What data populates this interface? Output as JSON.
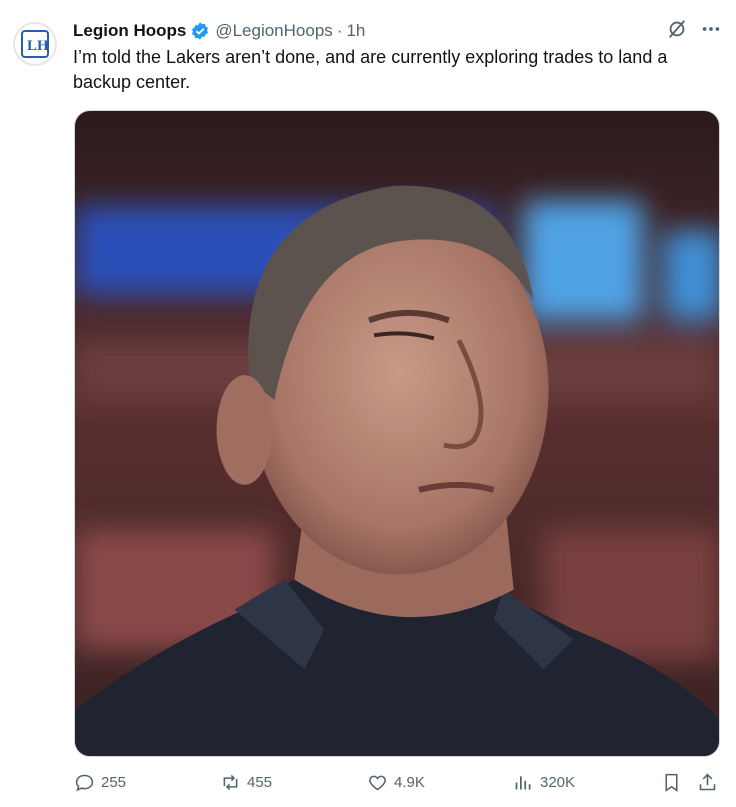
{
  "tweet": {
    "author_name": "Legion Hoops",
    "handle": "@LegionHoops",
    "separator": "·",
    "time": "1h",
    "text": "I’m told the Lakers aren’t done, and are currently exploring trades to land a backup center.",
    "avatar_letters": "LH"
  },
  "actions": {
    "replies": "255",
    "reposts": "455",
    "likes": "4.9K",
    "views": "320K"
  },
  "icons": [
    "verified-badge-icon",
    "grok-icon",
    "more-icon",
    "reply-icon",
    "repost-icon",
    "like-icon",
    "views-icon",
    "bookmark-icon",
    "share-icon"
  ],
  "colors": {
    "verified": "#1d9bf0",
    "muted": "#536471",
    "text": "#0f1419"
  }
}
